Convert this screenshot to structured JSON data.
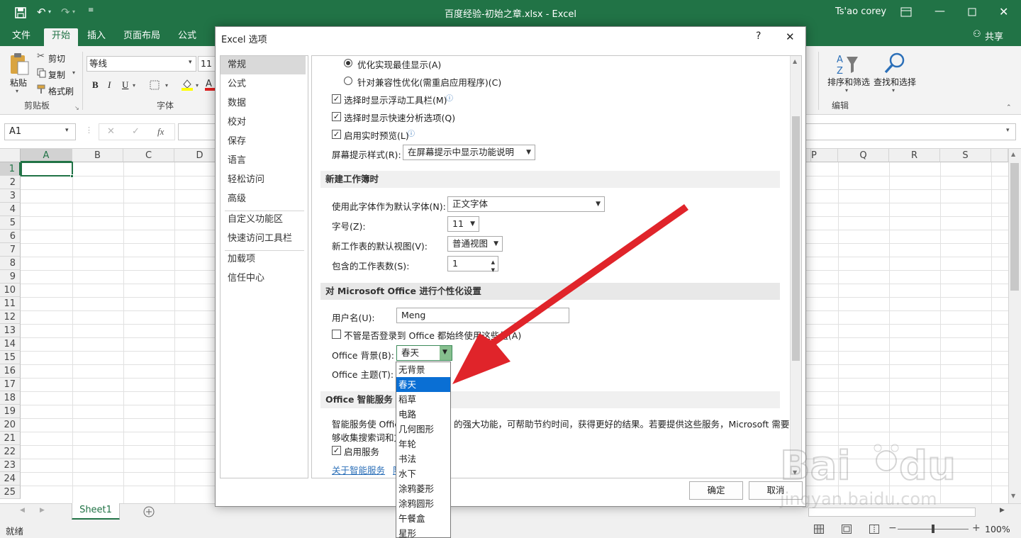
{
  "window": {
    "title": "百度经验-初始之章.xlsx  -  Excel",
    "user": "Ts'ao corey",
    "share": "共享"
  },
  "tabs": [
    {
      "label": "文件"
    },
    {
      "label": "开始"
    },
    {
      "label": "插入"
    },
    {
      "label": "页面布局"
    },
    {
      "label": "公式"
    }
  ],
  "ribbon": {
    "paste": "粘贴",
    "cut": "剪切",
    "copy": "复制",
    "format_painter": "格式刷",
    "clipboard_group": "剪贴板",
    "font_name": "等线",
    "font_size": "11",
    "font_group": "字体",
    "bold": "B",
    "italic": "I",
    "underline": "U",
    "sort_filter": "排序和筛选",
    "find_select": "查找和选择",
    "edit_group": "编辑"
  },
  "formula_bar": {
    "name_box": "A1",
    "fx": "fx",
    "value": ""
  },
  "grid": {
    "columns": [
      "A",
      "B",
      "C",
      "D",
      "P",
      "Q",
      "R",
      "S"
    ],
    "rows": [
      "1",
      "2",
      "3",
      "4",
      "5",
      "6",
      "7",
      "8",
      "9",
      "10",
      "11",
      "12",
      "13",
      "14",
      "15",
      "16",
      "17",
      "18",
      "19",
      "20",
      "21",
      "22",
      "23",
      "24",
      "25"
    ],
    "sheet": "Sheet1"
  },
  "status": {
    "ready": "就绪",
    "zoom": "100%"
  },
  "dialog": {
    "title": "Excel 选项",
    "help": "?",
    "nav": [
      "常规",
      "公式",
      "数据",
      "校对",
      "保存",
      "语言",
      "轻松访问",
      "高级",
      "自定义功能区",
      "快速访问工具栏",
      "加载项",
      "信任中心"
    ],
    "display_options": {
      "radio_best": "优化实现最佳显示(A)",
      "radio_compat": "针对兼容性优化(需重启应用程序)(C)",
      "mini_toolbar": "选择时显示浮动工具栏(M)",
      "quick_analysis": "选择时显示快速分析选项(Q)",
      "live_preview": "启用实时预览(L)",
      "screentip_label": "屏幕提示样式(R):",
      "screentip_value": "在屏幕提示中显示功能说明"
    },
    "new_workbook": {
      "header": "新建工作簿时",
      "font_label": "使用此字体作为默认字体(N):",
      "font_value": "正文字体",
      "size_label": "字号(Z):",
      "size_value": "11",
      "view_label": "新工作表的默认视图(V):",
      "view_value": "普通视图",
      "sheets_label": "包含的工作表数(S):",
      "sheets_value": "1"
    },
    "personalize": {
      "header": "对 Microsoft Office 进行个性化设置",
      "username_label": "用户名(U):",
      "username_value": "Meng",
      "always_use": "不管是否登录到 Office 都始终使用这些值(A)",
      "background_label": "Office 背景(B):",
      "background_value": "春天",
      "theme_label": "Office 主题(T):"
    },
    "intelligent": {
      "header": "Office 智能服务",
      "desc_1a": "智能服务使 Offic",
      "desc_1b": "的强大功能，可帮助节约时间，获得更好的结果。若要提供这些服务，Microsoft 需要能",
      "desc_2": "够收集搜索词和文",
      "enable": "启用服务",
      "about_link": "关于智能服务",
      "privacy_link": "隐"
    },
    "ok": "确定",
    "cancel": "取消"
  },
  "dropdown": {
    "items": [
      "无背景",
      "春天",
      "稻草",
      "电路",
      "几何图形",
      "年轮",
      "书法",
      "水下",
      "涂鸦菱形",
      "涂鸦圆形",
      "午餐盒",
      "星形"
    ],
    "highlighted": "春天"
  },
  "watermark": {
    "text": "jingyan.baidu.com"
  },
  "colors": {
    "excel_green": "#217346",
    "highlight_blue": "#0a6fd4",
    "arrow_red": "#e0242a"
  }
}
